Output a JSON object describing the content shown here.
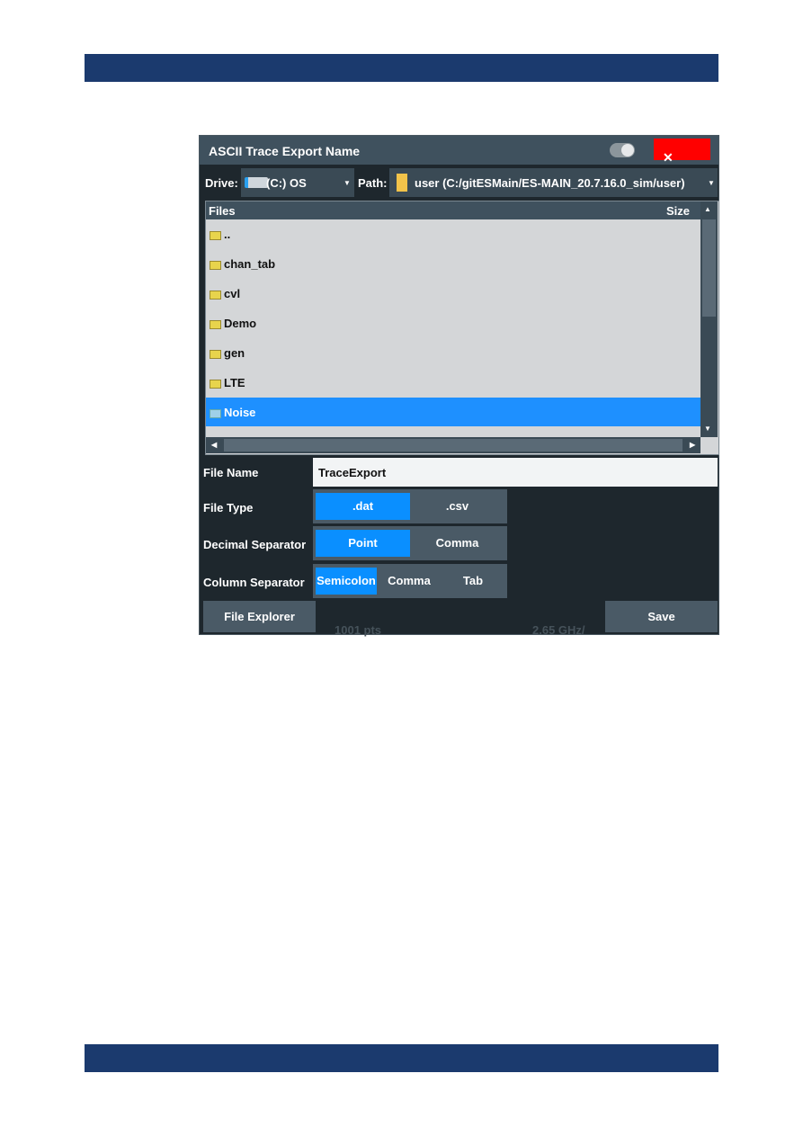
{
  "dialog": {
    "title": "ASCII Trace Export Name",
    "close_icon": "close-icon",
    "drive_label": "Drive:",
    "drive_value": "(C:) OS",
    "path_label": "Path:",
    "path_value": "user (C:/gitESMain/ES-MAIN_20.7.16.0_sim/user)",
    "files_header": "Files",
    "size_header": "Size",
    "files": [
      {
        "name": ".."
      },
      {
        "name": "chan_tab"
      },
      {
        "name": "cvl"
      },
      {
        "name": "Demo"
      },
      {
        "name": "gen"
      },
      {
        "name": "LTE"
      },
      {
        "name": "Noise",
        "selected": true
      }
    ],
    "file_name_label": "File Name",
    "file_name_value": "TraceExport",
    "file_type_label": "File Type",
    "file_type_options": [
      ".dat",
      ".csv"
    ],
    "file_type_selected": ".dat",
    "decimal_label": "Decimal Separator",
    "decimal_options": [
      "Point",
      "Comma"
    ],
    "decimal_selected": "Point",
    "column_label": "Column Separator",
    "column_options": [
      "Semicolon",
      "Comma",
      "Tab"
    ],
    "column_selected": "Semicolon",
    "file_explorer_label": "File Explorer",
    "save_label": "Save",
    "background_text": [
      "1001 pts",
      "2.65 GHz/"
    ]
  },
  "colors": {
    "accent": "#0a8fff",
    "close": "#ff0000",
    "header_bar": "#1b3a6e"
  }
}
